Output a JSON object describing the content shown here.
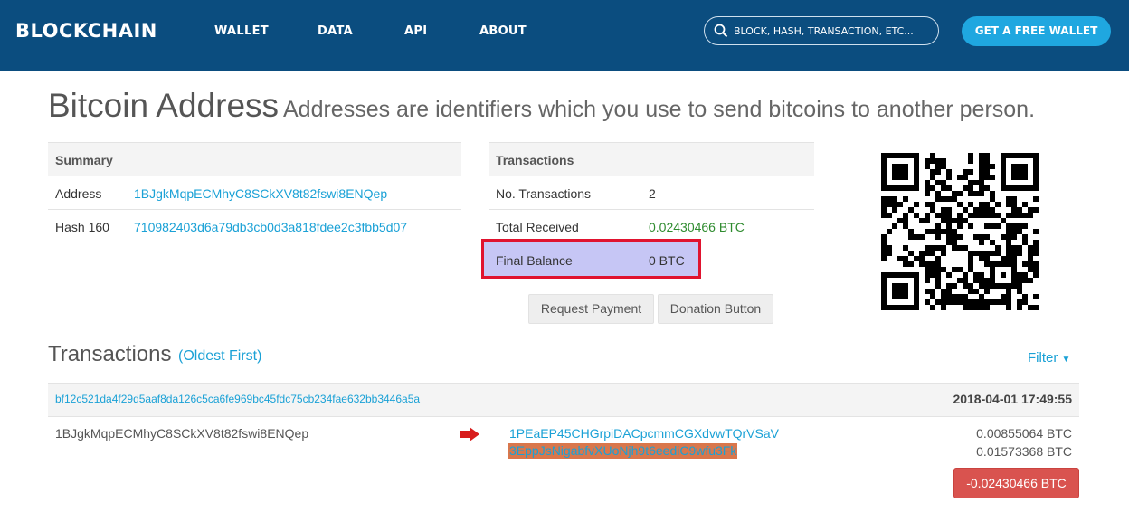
{
  "header": {
    "logo": "BLOCKCHAIN",
    "nav": [
      "WALLET",
      "DATA",
      "API",
      "ABOUT"
    ],
    "search_placeholder": "BLOCK, HASH, TRANSACTION, ETC...",
    "search_icon": "search-icon",
    "cta": "GET A FREE WALLET",
    "colors": {
      "bar": "#0b4d7f",
      "cta": "#1fa7e0"
    }
  },
  "page": {
    "title": "Bitcoin Address",
    "subtitle": "Addresses are identifiers which you use to send bitcoins to another person."
  },
  "summary": {
    "heading": "Summary",
    "rows": [
      {
        "label": "Address",
        "value": "1BJgkMqpECMhyC8SCkXV8t82fswi8ENQep"
      },
      {
        "label": "Hash 160",
        "value": "710982403d6a79db3cb0d3a818fdee2c3fbb5d07"
      }
    ]
  },
  "transactions_summary": {
    "heading": "Transactions",
    "rows": [
      {
        "label": "No. Transactions",
        "value": "2"
      },
      {
        "label": "Total Received",
        "value": "0.02430466 BTC"
      }
    ],
    "final_balance": {
      "label": "Final Balance",
      "value": "0 BTC"
    }
  },
  "buttons": {
    "request_payment": "Request Payment",
    "donation": "Donation Button"
  },
  "transactions": {
    "title": "Transactions",
    "order": "(Oldest First)",
    "filter": "Filter",
    "items": [
      {
        "hash": "bf12c521da4f29d5aaf8da126c5ca6fe969bc45fdc75cb234fae632bb3446a5a",
        "time": "2018-04-01 17:49:55",
        "from": "1BJgkMqpECMhyC8SCkXV8t82fswi8ENQep",
        "outputs": [
          {
            "address": "1PEaEP45CHGrpiDACpcmmCGXdvwTQrVSaV",
            "amount": "0.00855064 BTC"
          },
          {
            "address": "3EppJsNigabfvXUoNjh9t6eediC9wfu3Fk",
            "amount": "0.01573368 BTC"
          }
        ],
        "total": "-0.02430466 BTC"
      }
    ]
  }
}
